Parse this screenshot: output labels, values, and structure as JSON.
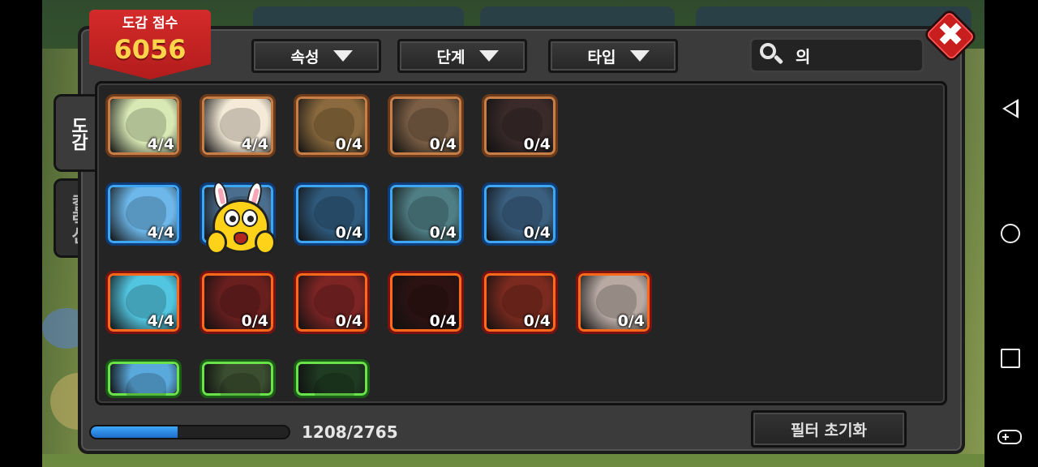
{
  "score": {
    "label": "도감 점수",
    "value": "6056"
  },
  "filters": [
    {
      "label": "속성"
    },
    {
      "label": "단계"
    },
    {
      "label": "타입"
    }
  ],
  "search": {
    "value": "의",
    "icon": "search-icon"
  },
  "tabs": [
    {
      "label": "도감",
      "active": true
    },
    {
      "label": "컬렉션",
      "active": false
    }
  ],
  "cards": [
    {
      "count": "4/4",
      "element": "earth",
      "color": "#d8e9b5"
    },
    {
      "count": "4/4",
      "element": "earth",
      "color": "#f4ead7"
    },
    {
      "count": "0/4",
      "element": "earth",
      "color": "#8a6a3e"
    },
    {
      "count": "0/4",
      "element": "earth",
      "color": "#7a5e45"
    },
    {
      "count": "0/4",
      "element": "earth",
      "color": "#3a2a2a"
    },
    {
      "count": "4/4",
      "element": "water",
      "color": "#6db7ea"
    },
    {
      "count": "",
      "element": "water",
      "color": "#4b6e8f"
    },
    {
      "count": "0/4",
      "element": "water",
      "color": "#2f5a7c"
    },
    {
      "count": "0/4",
      "element": "water",
      "color": "#4f7e84"
    },
    {
      "count": "0/4",
      "element": "water",
      "color": "#3a5f7f"
    },
    {
      "count": "4/4",
      "element": "fire",
      "color": "#52c5e0"
    },
    {
      "count": "0/4",
      "element": "fire",
      "color": "#6a1f1f"
    },
    {
      "count": "0/4",
      "element": "fire",
      "color": "#7d2424"
    },
    {
      "count": "0/4",
      "element": "fire",
      "color": "#2c1212"
    },
    {
      "count": "0/4",
      "element": "fire",
      "color": "#7a2a1e"
    },
    {
      "count": "0/4",
      "element": "fire",
      "color": "#b8a9a3"
    },
    {
      "count": "",
      "element": "grass",
      "color": "#5aa9dc"
    },
    {
      "count": "",
      "element": "grass",
      "color": "#3b4f30"
    },
    {
      "count": "",
      "element": "grass",
      "color": "#1f3b22"
    }
  ],
  "progress": {
    "text": "1208/2765",
    "fraction": 0.437
  },
  "reset_button": {
    "label": "필터 초기화"
  },
  "colors": {
    "accent_red": "#c91e1e",
    "score_gold": "#ffd34a",
    "progress_blue": "#2b8ae8"
  }
}
